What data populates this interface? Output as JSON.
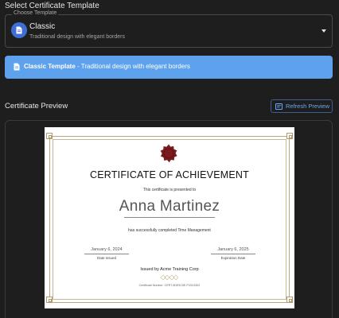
{
  "header": {
    "select_title": "Select Certificate Template"
  },
  "template_select": {
    "legend": "Choose Template",
    "selected_name": "Classic",
    "selected_desc": "Traditional design with elegant borders",
    "icon": "document-icon"
  },
  "info_banner": {
    "name": "Classic Template",
    "separator": " - ",
    "desc": "Traditional design with elegant borders",
    "color": "#5ea2ee"
  },
  "preview": {
    "title": "Certificate Preview",
    "refresh_label": "Refresh Preview"
  },
  "certificate": {
    "title": "CERTIFICATE OF ACHIEVEMENT",
    "presented": "This certificate is presented to",
    "recipient": "Anna Martinez",
    "completed": "has successfully completed Time Management",
    "date_issued": "January 6, 2024",
    "date_issued_label": "Date Issued",
    "expiration": "January 6, 2025",
    "expiration_label": "Expiration Date",
    "issuer": "Issued by Acme Training Corp",
    "number": "Certificate Number: CERT-5DE5C5E-F03C4302",
    "seal_color": "#7a1a1e",
    "border_color": "#b9a680"
  },
  "colors": {
    "accent": "#3f6fd6",
    "link": "#6aa6f0",
    "background": "#1e1e1e"
  }
}
